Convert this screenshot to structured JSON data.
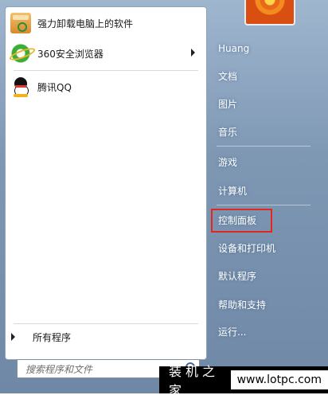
{
  "programs": [
    {
      "label": "强力卸载电脑上的软件",
      "icon": "uninstall-box-icon"
    },
    {
      "label": "360安全浏览器",
      "icon": "browser-360-icon",
      "has_submenu": true
    },
    {
      "label": "腾讯QQ",
      "icon": "qq-penguin-icon"
    }
  ],
  "all_programs_label": "所有程序",
  "search": {
    "placeholder": "搜索程序和文件"
  },
  "right_items": {
    "user": "Huang",
    "documents": "文档",
    "pictures": "图片",
    "music": "音乐",
    "games": "游戏",
    "computer": "计算机",
    "control_panel": "控制面板",
    "devices": "设备和打印机",
    "default_programs": "默认程序",
    "help": "帮助和支持",
    "run": "运行..."
  },
  "highlight_color": "#e3271f",
  "watermark": {
    "site_name": "装机之家",
    "url": "www.lotpc.com"
  }
}
